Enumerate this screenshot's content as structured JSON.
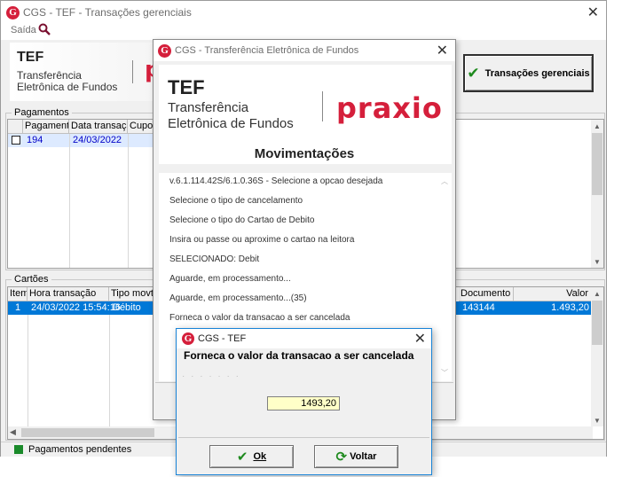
{
  "main_window": {
    "title": "CGS - TEF - Transações gerenciais",
    "menu_saida": "Saída",
    "brand_tef": "TEF",
    "brand_line1": "Transferência",
    "brand_line2": "Eletrônica de Fundos",
    "transacoes_button": "Transações gerenciais",
    "pagamentos_label": "Pagamentos",
    "pagamentos_columns": [
      "Pagamento",
      "Data transação",
      "Cupom"
    ],
    "pagamentos_rows": [
      {
        "pagamento": "194",
        "data": "24/03/2022"
      }
    ],
    "cartoes_label": "Cartões",
    "cartoes_columns": [
      "Item",
      "Hora transação",
      "Tipo movto.",
      "Documento",
      "Valor"
    ],
    "cartoes_rows": [
      {
        "item": "1",
        "hora": "24/03/2022 15:54:16",
        "tipo": "Débito",
        "documento": "143144",
        "valor": "1.493,20"
      }
    ],
    "legend_pendentes": "Pagamentos pendentes",
    "colors": {
      "green_legend": "#1a8a2a",
      "selection": "#0078d7",
      "row_blue": "#0000c8"
    }
  },
  "tef_window": {
    "title": "CGS - Transferência Eletrônica de Fundos",
    "brand_tef": "TEF",
    "brand_line1": "Transferência",
    "brand_line2": "Eletrônica de Fundos",
    "praxio_logo": "praxio",
    "heading": "Movimentações",
    "log_lines": [
      "v.6.1.114.42S/6.1.0.36S - Selecione a opcao desejada",
      "Selecione o tipo de cancelamento",
      "Selecione o tipo do Cartao de Debito",
      "Insira ou passe ou aproxime o cartao na leitora",
      "SELECIONADO:   Debit",
      "Aguarde, em processamento...",
      "Aguarde, em processamento...(35)",
      "Forneca o valor da transacao a ser cancelada"
    ]
  },
  "dialog": {
    "title": "CGS - TEF",
    "prompt": "Forneca o valor da transacao a ser cancelada",
    "amount_value": "1493,20",
    "ok_label": "Ok",
    "voltar_label": "Voltar"
  }
}
